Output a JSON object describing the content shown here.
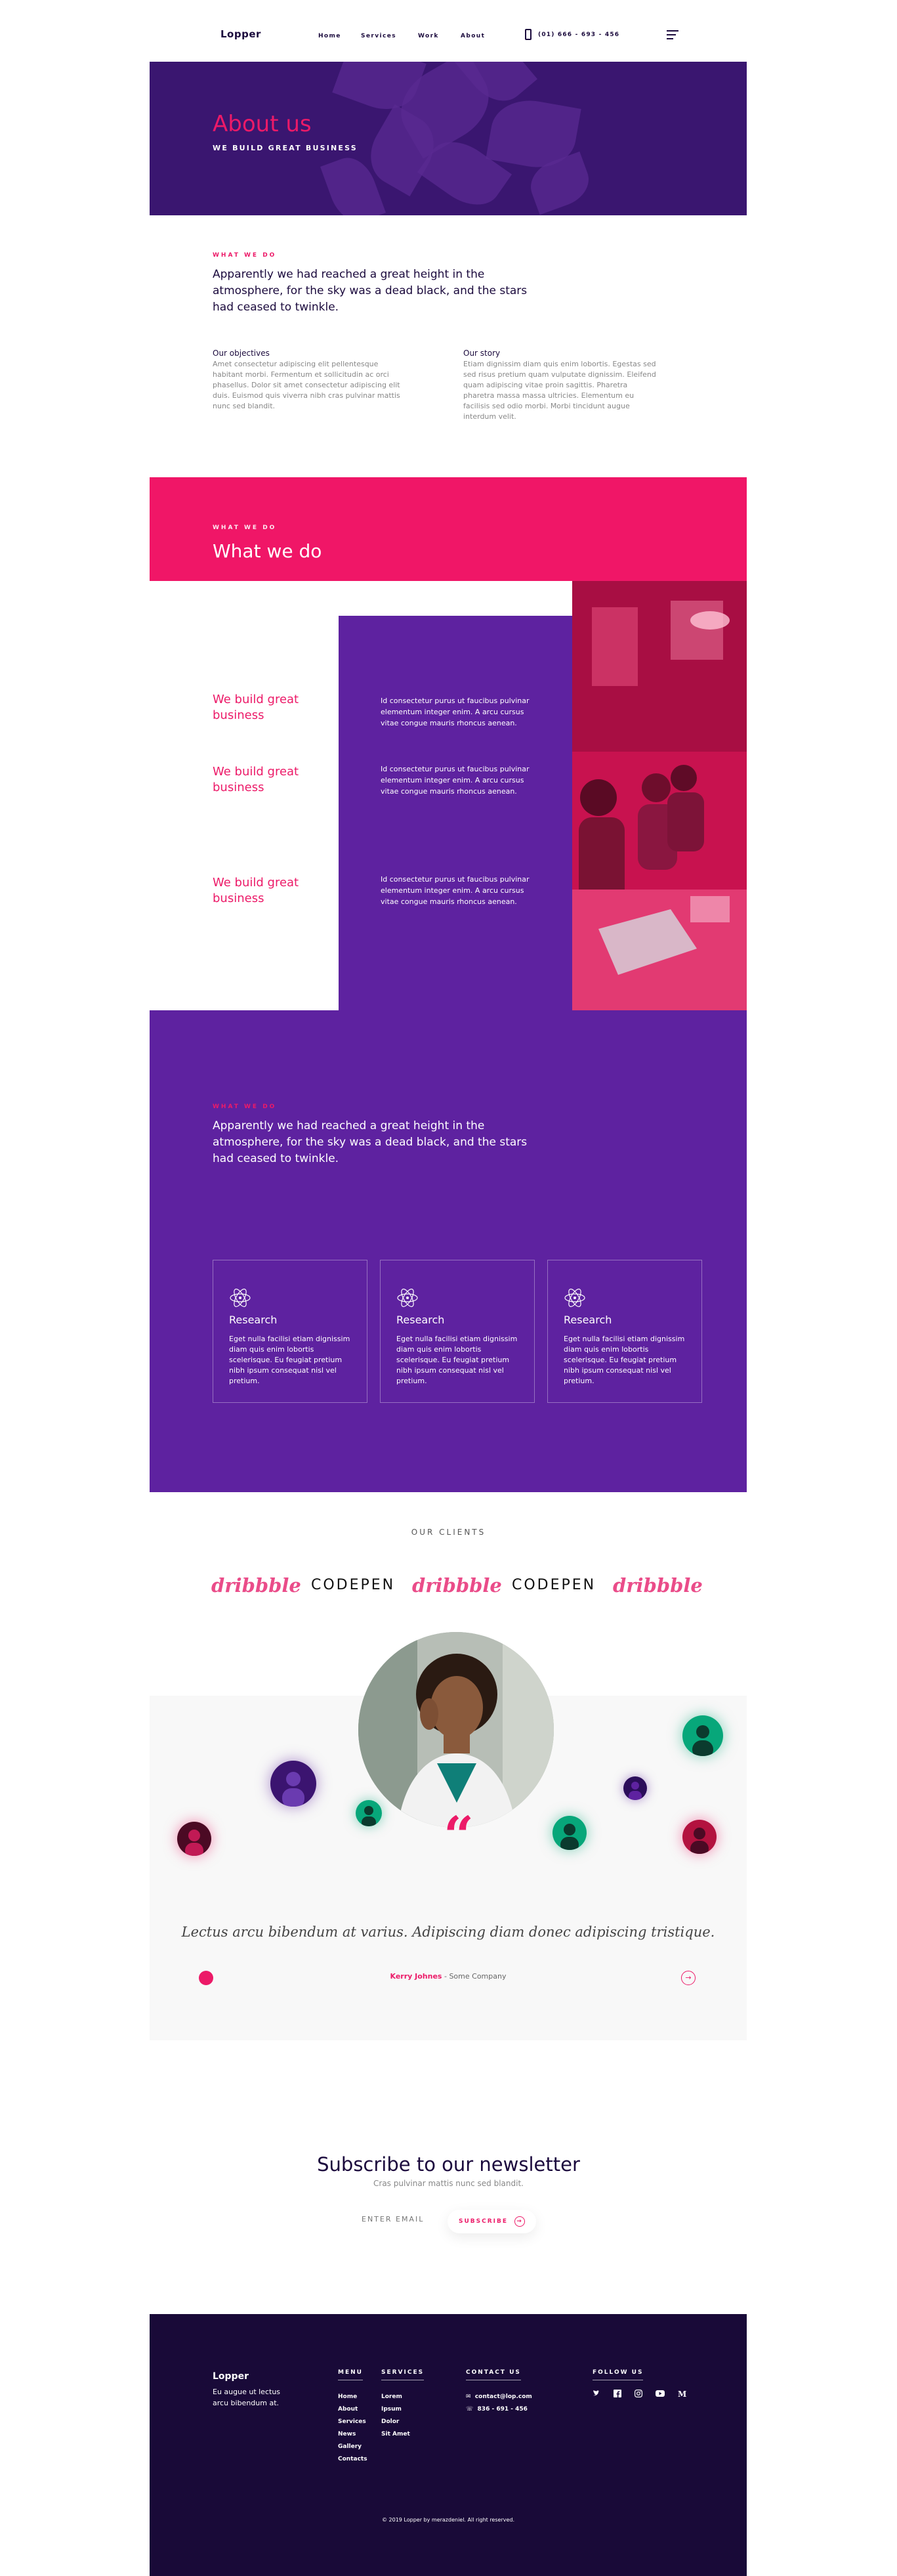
{
  "header": {
    "logo": "Lopper",
    "nav": [
      "Home",
      "Services",
      "Work",
      "About"
    ],
    "phone": "(01) 666 - 693 - 456"
  },
  "hero": {
    "title": "About us",
    "subtitle": "WE BUILD GREAT BUSINESS"
  },
  "intro": {
    "eyebrow": "WHAT WE DO",
    "lead": "Apparently we had reached a great height in the atmosphere, for the sky was a dead black, and the stars had ceased to twinkle.",
    "objectives_title": "Our objectives",
    "objectives_text": "Amet consectetur adipiscing elit pellentesque habitant morbi. Fermentum et sollicitudin ac orci phasellus. Dolor sit amet consectetur adipiscing elit duis. Euismod quis viverra nibh cras pulvinar mattis nunc sed blandit.",
    "story_title": "Our story",
    "story_text": "Etiam dignissim diam quis enim lobortis. Egestas sed sed risus pretium quam vulputate dignissim. Eleifend quam adipiscing vitae proin sagittis. Pharetra pharetra massa massa ultricies. Elementum eu facilisis sed odio morbi. Morbi tincidunt augue interdum velit."
  },
  "what_we_do": {
    "eyebrow": "WHAT WE DO",
    "title": "What we do",
    "items": [
      {
        "title": "We build great business",
        "text": "Id consectetur purus ut faucibus pulvinar elementum integer enim. A arcu cursus vitae congue mauris rhoncus aenean."
      },
      {
        "title": "We build great business",
        "text": "Id consectetur purus ut faucibus pulvinar elementum integer enim. A arcu cursus vitae congue mauris rhoncus aenean."
      },
      {
        "title": "We build great business",
        "text": "Id consectetur purus ut faucibus pulvinar elementum integer enim. A arcu cursus vitae congue mauris rhoncus aenean."
      }
    ]
  },
  "band": {
    "eyebrow": "WHAT WE DO",
    "lead": "Apparently we had reached a great height in the atmosphere, for the sky was a dead black, and the stars had ceased to twinkle.",
    "cards": [
      {
        "icon": "atom-icon",
        "title": "Research",
        "text": "Eget nulla facilisi etiam dignissim diam quis enim lobortis scelerisque. Eu feugiat pretium nibh ipsum consequat nisl vel pretium."
      },
      {
        "icon": "atom-icon",
        "title": "Research",
        "text": "Eget nulla facilisi etiam dignissim diam quis enim lobortis scelerisque. Eu feugiat pretium nibh ipsum consequat nisl vel pretium."
      },
      {
        "icon": "atom-icon",
        "title": "Research",
        "text": "Eget nulla facilisi etiam dignissim diam quis enim lobortis scelerisque. Eu feugiat pretium nibh ipsum consequat nisl vel pretium."
      }
    ]
  },
  "clients": {
    "title": "OUR CLIENTS",
    "logos": [
      "dribbble",
      "CODEPEN",
      "dribbble",
      "CODEPEN",
      "dribbble"
    ]
  },
  "testimonial": {
    "quote": "Lectus arcu bibendum at varius. Adipiscing diam donec adipiscing tristique.",
    "author": "Kerry Johnes",
    "company": "- Some Company"
  },
  "newsletter": {
    "title": "Subscribe to our newsletter",
    "subtitle": "Cras pulvinar mattis nunc sed blandit.",
    "placeholder": "ENTER EMAIL",
    "button": "SUBSCRIBE"
  },
  "footer": {
    "logo": "Lopper",
    "tagline": "Eu augue ut lectus arcu bibendum at.",
    "menu_title": "MENU",
    "menu": [
      "Home",
      "About",
      "Services",
      "News",
      "Gallery",
      "Contacts"
    ],
    "services_title": "SERVICES",
    "services": [
      "Lorem",
      "Ipsum",
      "Dolor",
      "Sit Amet"
    ],
    "contact_title": "CONTACT US",
    "email": "contact@lop.com",
    "phone": "836 - 691 - 456",
    "follow_title": "FOLLOW US",
    "copyright": "© 2019 Lopper by merazdeniel. All right reserved."
  },
  "colors": {
    "accent": "#ec1a68",
    "purple": "#5e22a0",
    "dark": "#190a38"
  }
}
